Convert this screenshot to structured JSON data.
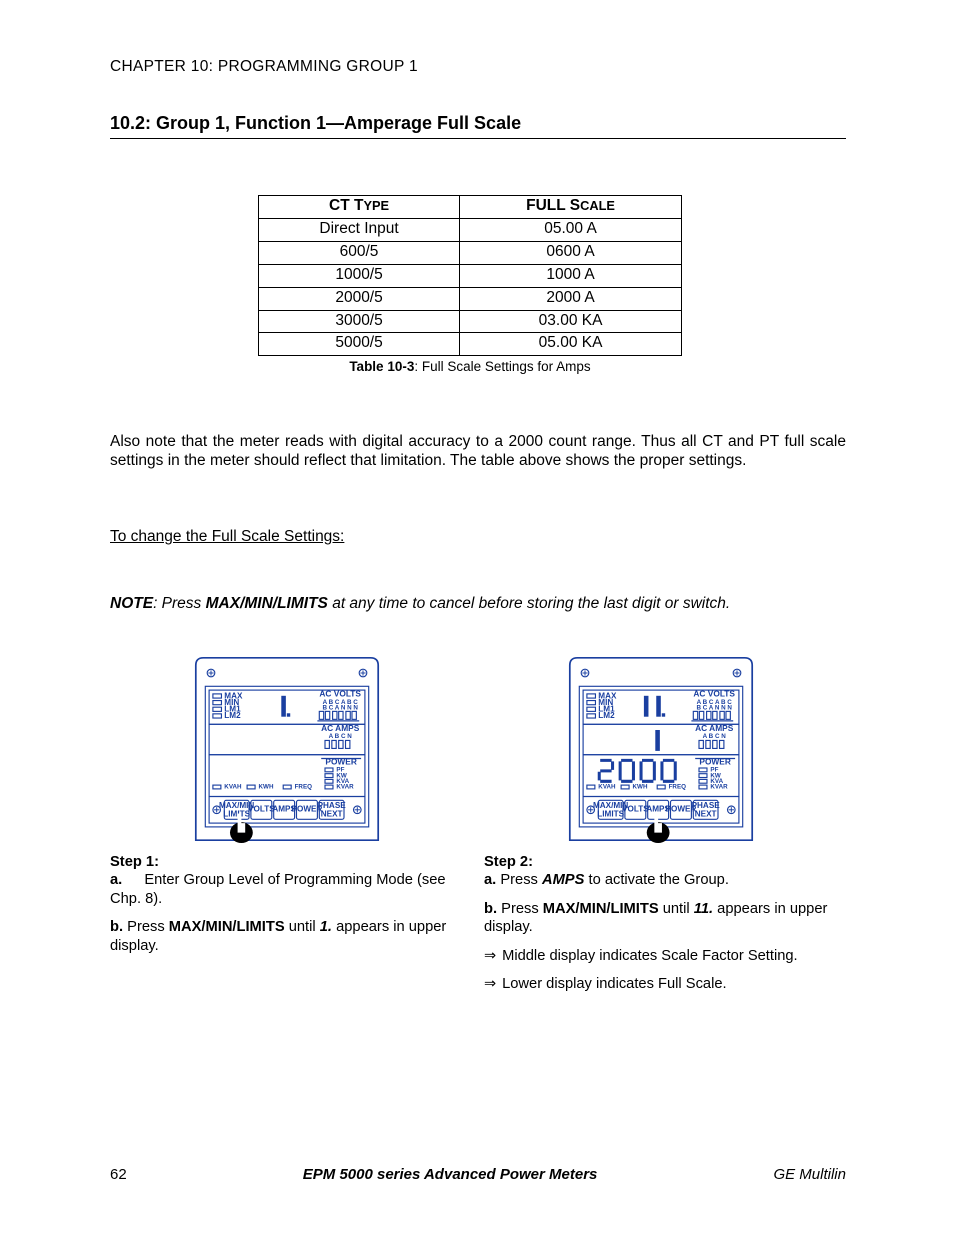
{
  "chapter_header": "CHAPTER 10: PROGRAMMING GROUP 1",
  "section_title": "10.2: Group 1, Function 1—Amperage Full Scale",
  "table": {
    "headers": {
      "col1_a": "CT T",
      "col1_b": "YPE",
      "col2_a": "FULL S",
      "col2_b": "CALE"
    },
    "rows": [
      {
        "ct": "Direct Input",
        "fs": "05.00 A"
      },
      {
        "ct": "600/5",
        "fs": "0600 A"
      },
      {
        "ct": "1000/5",
        "fs": "1000 A"
      },
      {
        "ct": "2000/5",
        "fs": "2000 A"
      },
      {
        "ct": "3000/5",
        "fs": "03.00 KA"
      },
      {
        "ct": "5000/5",
        "fs": "05.00 KA"
      }
    ],
    "caption_bold": "Table 10-3",
    "caption_rest": ": Full Scale Settings for Amps"
  },
  "para1": "Also note that the meter reads with digital accuracy to a 2000 count range. Thus all CT and PT full scale settings in the meter should reflect that limitation. The table above shows the proper settings.",
  "para2": "To change the Full Scale Settings:",
  "note": {
    "lead_b": "NOTE",
    "lead_after": ":  Press ",
    "btn": "MAX/MIN/LIMITS",
    "tail": " at any time to cancel before storing the last digit or switch."
  },
  "device": {
    "labels": {
      "max": "MAX",
      "min": "MIN",
      "lm1": "LM1",
      "lm2": "LM2",
      "ac_volts": "AC VOLTS",
      "volts_sub1": "A  B  C  A  B  C",
      "volts_sub2": "B  C  A  N  N  N",
      "ac_amps": "AC AMPS",
      "amps_sub": "A  B  C  N",
      "power": "POWER",
      "pf": "PF",
      "kw": "KW",
      "kva": "KVA",
      "kvar": "KVAR",
      "kvah": "KVAH",
      "kwh": "KWH",
      "freq": "FREQ",
      "btns": {
        "maxmin_top": "MAX/MIN",
        "maxmin_bot": "LIMITS",
        "volts": "VOLTS",
        "amps": "AMPS",
        "power": "POWER",
        "phase_top": "PHASE",
        "phase_bot": "NEXT"
      }
    },
    "upper1": "1.",
    "upper1_small": "1",
    "upper2": "11.",
    "mid2": "1",
    "low2": "2000"
  },
  "steps": {
    "s1_title": "Step 1:",
    "s1_a": "Enter Group Level of Programming Mode (see Chp. 8).",
    "s1_b_pre": "Press ",
    "s1_b_btn": "MAX/MIN/LIMITS",
    "s1_b_mid": " until ",
    "s1_b_num": "1.",
    "s1_b_post": " appears in upper display.",
    "s2_title": "Step 2:",
    "s2_a_pre": "Press ",
    "s2_a_btn": "AMPS",
    "s2_a_post": " to activate the Group.",
    "s2_b_pre": "Press ",
    "s2_b_btn": "MAX/MIN/LIMITS",
    "s2_b_mid": " until ",
    "s2_b_num": "11.",
    "s2_b_post": " appears in upper display.",
    "s2_c": "Middle display indicates Scale Factor Setting.",
    "s2_d": "Lower display indicates Full Scale."
  },
  "footer": {
    "page": "62",
    "title": "EPM 5000 series Advanced Power Meters",
    "brand": "GE Multilin"
  }
}
